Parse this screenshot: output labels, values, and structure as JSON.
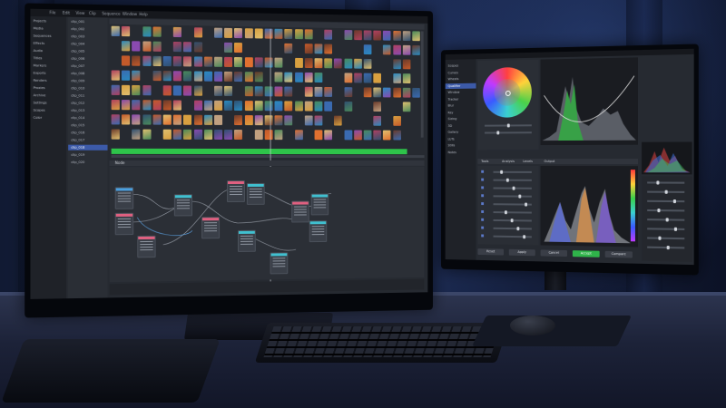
{
  "colors": {
    "wall": "#172447",
    "desk": "#2d3550",
    "screen_bg": "#262a31",
    "panel_bg": "#1f2228",
    "selection": "#3c5aa8",
    "timeline_green": "#2ec44a",
    "accept_button": "#2fb44a"
  },
  "left_monitor": {
    "window_title": "",
    "menu": [
      "File",
      "Edit",
      "View",
      "Clip",
      "Sequence",
      "Window",
      "Help"
    ],
    "sidebar_items": [
      "Projects",
      "Media",
      "Sequences",
      "Effects",
      "Audio",
      "Titles",
      "Markers",
      "Exports",
      "Renders",
      "Proxies",
      "Archive",
      "Settings",
      "Scopes",
      "Color"
    ],
    "bin_items": [
      "clip_001",
      "clip_002",
      "clip_003",
      "clip_004",
      "clip_005",
      "clip_006",
      "clip_007",
      "clip_008",
      "clip_009",
      "clip_010",
      "clip_011",
      "clip_012",
      "clip_013",
      "clip_014",
      "clip_015",
      "clip_016",
      "clip_017",
      "clip_018",
      "clip_019",
      "clip_020"
    ],
    "selected_bin_item": "clip_018",
    "node_panel_tab": "Node"
  },
  "right_monitor": {
    "sidebar_items": [
      "Scopes",
      "Curves",
      "Wheels",
      "Qualifier",
      "Window",
      "Tracker",
      "Blur",
      "Key",
      "Sizing",
      "3D",
      "Gallery",
      "LUTs",
      "Stills",
      "Notes"
    ],
    "selected_sidebar_item": "Qualifier",
    "tabs": [
      "Tools",
      "Analysis",
      "Levels",
      "Output"
    ],
    "buttons": [
      "Reset",
      "Apply",
      "Cancel",
      "Accept",
      "Compare"
    ],
    "accept_button_label": "Accept"
  },
  "icons": [
    "color-wheel-icon",
    "histogram-icon",
    "node-graph-icon",
    "timeline-icon",
    "keyboard-icon",
    "mouse-icon"
  ]
}
